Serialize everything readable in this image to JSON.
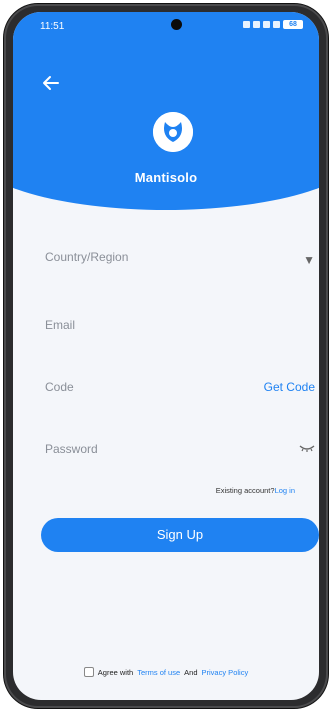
{
  "status_bar": {
    "time": "11:51",
    "battery": "68"
  },
  "brand": {
    "name": "Mantisolo"
  },
  "form": {
    "country_label": "Country/Region",
    "email_label": "Email",
    "code_label": "Code",
    "get_code_label": "Get Code",
    "password_label": "Password"
  },
  "existing": {
    "text": "Existing account?",
    "login": "Log in"
  },
  "signup_label": "Sign Up",
  "agree": {
    "prefix": "Agree with",
    "terms": "Terms of use",
    "and": "And",
    "privacy": "Privacy Policy"
  },
  "colors": {
    "primary": "#1f82f2",
    "background": "#f4f6fa"
  },
  "icons": [
    "back-arrow-icon",
    "dropdown-chevron-icon",
    "eye-closed-icon",
    "brand-logo-icon"
  ]
}
